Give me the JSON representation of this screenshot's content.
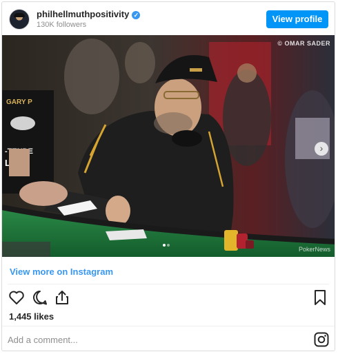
{
  "header": {
    "username": "philhellmuthpositivity",
    "followers": "130K followers",
    "view_profile_label": "View profile"
  },
  "photo": {
    "credit": "© OMAR SADER",
    "watermark": "PokerNews",
    "carousel_current": 1,
    "carousel_total": 2
  },
  "more_link_label": "View more on Instagram",
  "likes_label": "1,445 likes",
  "comment": {
    "placeholder": "Add a comment..."
  },
  "icons": {
    "verified": "verified-badge-icon",
    "heart": "heart-icon",
    "comment": "comment-icon",
    "share": "share-icon",
    "bookmark": "bookmark-icon",
    "instagram": "instagram-icon",
    "next": "chevron-right-icon"
  },
  "colors": {
    "accent": "#0095f6",
    "link": "#3897f0",
    "felt": "#1f7a3c"
  }
}
